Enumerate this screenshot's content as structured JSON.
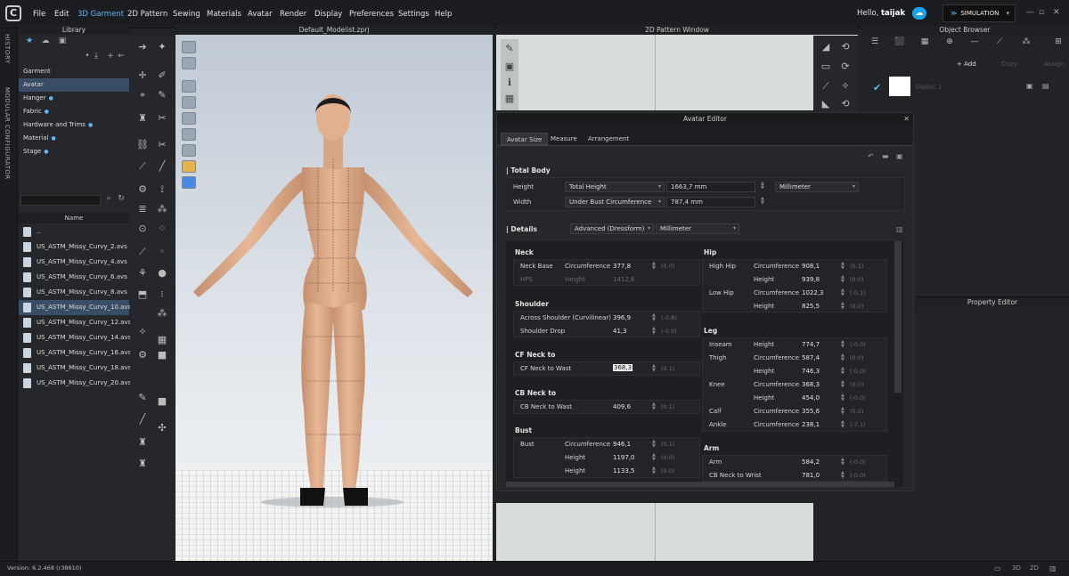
{
  "app": {
    "version": "Version: 6.2.468 (r38610)",
    "user_greeting": "Hello, ",
    "user_name": "taijak",
    "simulation_label": "SIMULATION"
  },
  "menu": [
    "File",
    "Edit",
    "3D Garment",
    "2D Pattern",
    "Sewing",
    "Materials",
    "Avatar",
    "Render",
    "Display",
    "Preferences",
    "Settings",
    "Help"
  ],
  "side_tabs": {
    "history": "HISTORY",
    "modular": "MODULAR CONFIGURATOR"
  },
  "library": {
    "title": "Library",
    "categories": [
      "Garment",
      "Avatar",
      "Hanger",
      "Fabric",
      "Hardware and Trims",
      "Material",
      "Stage"
    ],
    "selected_category": "Avatar",
    "name_header": "Name",
    "files": [
      "..",
      "US_ASTM_Missy_Curvy_2.avs",
      "US_ASTM_Missy_Curvy_4.avs",
      "US_ASTM_Missy_Curvy_6.avs",
      "US_ASTM_Missy_Curvy_8.avs",
      "US_ASTM_Missy_Curvy_10.avs",
      "US_ASTM_Missy_Curvy_12.avs",
      "US_ASTM_Missy_Curvy_14.avs",
      "US_ASTM_Missy_Curvy_16.avs",
      "US_ASTM_Missy_Curvy_18.avs",
      "US_ASTM_Missy_Curvy_20.avs"
    ],
    "selected_file": "US_ASTM_Missy_Curvy_10.avs"
  },
  "view3d": {
    "title": "Default_Modelist.zprj"
  },
  "pattern_window": {
    "title": "2D Pattern Window"
  },
  "object_browser": {
    "title": "Object Browser",
    "add": "Add",
    "copy": "Copy",
    "assign": "Assign",
    "fabric": "FABRIC 1"
  },
  "property_editor": {
    "title": "Property Editor"
  },
  "avatar_editor": {
    "title": "Avatar Editor",
    "tabs": [
      "Avatar Size",
      "Measure",
      "Arrangement"
    ],
    "total_body": {
      "title": "Total Body",
      "height_label": "Height",
      "height_type": "Total Height",
      "height_value": "1663,7 mm",
      "unit": "Millimeter",
      "width_label": "Width",
      "width_type": "Under Bust Circumference",
      "width_value": "787,4 mm"
    },
    "details": {
      "title": "Details",
      "mode": "Advanced (Dressform)",
      "unit": "Millimeter"
    },
    "left": {
      "neck": {
        "title": "Neck",
        "rows": [
          {
            "name": "Neck Base",
            "type": "Circumference",
            "value": "377,8",
            "range": "(0.0)",
            "dim": false
          },
          {
            "name": "HPS",
            "type": "Height",
            "value": "1412,6",
            "range": "",
            "dim": true
          }
        ]
      },
      "shoulder": {
        "title": "Shoulder",
        "rows": [
          {
            "name": "Across Shoulder (Curvilinear)",
            "type": "",
            "value": "396,9",
            "range": "(-0.8)"
          },
          {
            "name": "Shoulder Drop",
            "type": "",
            "value": "41,3",
            "range": "(-0.0)"
          }
        ]
      },
      "cfneck": {
        "title": "CF Neck to",
        "rows": [
          {
            "name": "CF Neck to Wast",
            "type": "",
            "value": "368,3",
            "range": "(0.1)"
          }
        ]
      },
      "cbneck": {
        "title": "CB Neck to",
        "rows": [
          {
            "name": "CB Neck to Wast",
            "type": "",
            "value": "409,6",
            "range": "(0.1)"
          }
        ]
      },
      "bust": {
        "title": "Bust",
        "rows": [
          {
            "name": "Bust",
            "type": "Circumference",
            "value": "946,1",
            "range": "(0.1)"
          },
          {
            "name": "",
            "type": "Height",
            "value": "1197,0",
            "range": "(0.0)"
          },
          {
            "name": "",
            "type": "Height",
            "value": "1133,5",
            "range": "(0.0)"
          }
        ]
      }
    },
    "right": {
      "hip": {
        "title": "Hip",
        "rows": [
          {
            "name": "High Hip",
            "type": "Circumference",
            "value": "908,1",
            "range": "(0.1)"
          },
          {
            "name": "",
            "type": "Height",
            "value": "939,8",
            "range": "(0.0)"
          },
          {
            "name": "Low Hip",
            "type": "Circumference",
            "value": "1022,3",
            "range": "(-0.1)"
          },
          {
            "name": "",
            "type": "Height",
            "value": "825,5",
            "range": "(0.0)"
          }
        ]
      },
      "leg": {
        "title": "Leg",
        "rows": [
          {
            "name": "Inseam",
            "type": "Height",
            "value": "774,7",
            "range": "(-0.0)"
          },
          {
            "name": "Thigh",
            "type": "Circumference",
            "value": "587,4",
            "range": "(0.0)"
          },
          {
            "name": "",
            "type": "Height",
            "value": "746,3",
            "range": "(-0.0)"
          },
          {
            "name": "Knee",
            "type": "Circumference",
            "value": "368,3",
            "range": "(0.0)"
          },
          {
            "name": "",
            "type": "Height",
            "value": "454,0",
            "range": "(-0.0)"
          },
          {
            "name": "Calf",
            "type": "Circumference",
            "value": "355,6",
            "range": "(0.0)"
          },
          {
            "name": "Ankle",
            "type": "Circumference",
            "value": "238,1",
            "range": "(-7.1)"
          }
        ]
      },
      "arm": {
        "title": "Arm",
        "rows": [
          {
            "name": "Arm",
            "type": "",
            "value": "584,2",
            "range": "(-0.0)"
          },
          {
            "name": "CB Neck to Wrist",
            "type": "",
            "value": "781,0",
            "range": "(-0.0)"
          }
        ]
      }
    }
  },
  "colors": {
    "accent": "#5db9f5",
    "selection": "#3a4d66",
    "panel": "#26272a"
  }
}
